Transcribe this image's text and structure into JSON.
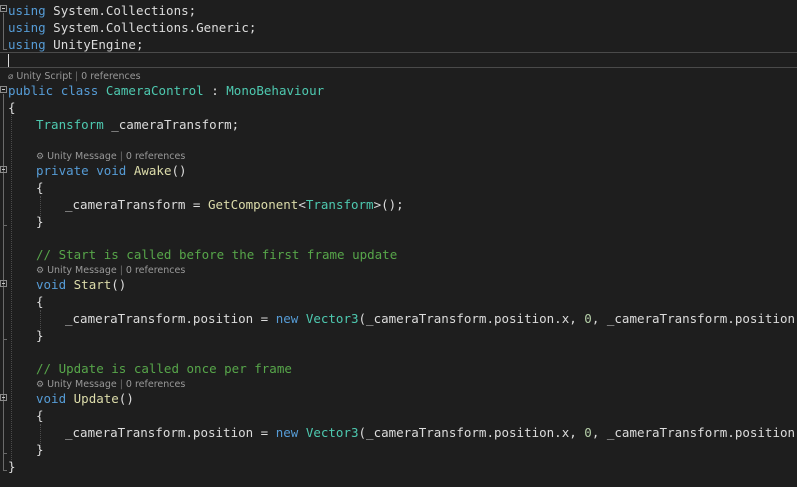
{
  "editor": {
    "usings": [
      {
        "keyword": "using",
        "ns": "System.Collections;"
      },
      {
        "keyword": "using",
        "ns": "System.Collections.Generic;"
      },
      {
        "keyword": "using",
        "ns": "UnityEngine;"
      }
    ],
    "class_lens": {
      "kind": "Unity Script",
      "refs": "0 references"
    },
    "class_decl": {
      "kw_public": "public",
      "kw_class": "class",
      "name": "CameraControl",
      "colon": " : ",
      "base": "MonoBehaviour"
    },
    "open_brace": "{",
    "close_brace": "}",
    "field": {
      "type": "Transform",
      "name": " _cameraTransform;"
    },
    "awake": {
      "lens": {
        "kind": "Unity Message",
        "refs": "0 references"
      },
      "kw_private": "private",
      "kw_void": "void",
      "name": "Awake",
      "parens": "()",
      "open": "{",
      "close": "}",
      "body": {
        "lhs": "_cameraTransform = ",
        "fn": "GetComponent",
        "lt": "<",
        "type": "Transform",
        "gt": ">();"
      }
    },
    "start": {
      "comment": "// Start is called before the first frame update",
      "lens": {
        "kind": "Unity Message",
        "refs": "0 references"
      },
      "kw_void": "void",
      "name": "Start",
      "parens": "()",
      "open": "{",
      "close": "}"
    },
    "update": {
      "comment": "// Update is called once per frame",
      "lens": {
        "kind": "Unity Message",
        "refs": "0 references"
      },
      "kw_void": "void",
      "name": "Update",
      "parens": "()",
      "open": "{",
      "close": "}"
    },
    "assign": {
      "p1": "_cameraTransform.position = ",
      "kw_new": "new",
      "type": "Vector3",
      "p2": "(_cameraTransform.position.x, ",
      "zero": "0",
      "p3": ", _cameraTransform.position.z);"
    }
  },
  "colors": {
    "background": "#1e1e1e",
    "keyword": "#569cd6",
    "type": "#4ec9b0",
    "method": "#dcdcaa",
    "number": "#b5cea8",
    "comment": "#57a64a",
    "text": "#dcdcdc",
    "codelens": "#999999"
  },
  "icons": {
    "codelens_message": "gear-icon",
    "fold": "collapse-icon"
  }
}
